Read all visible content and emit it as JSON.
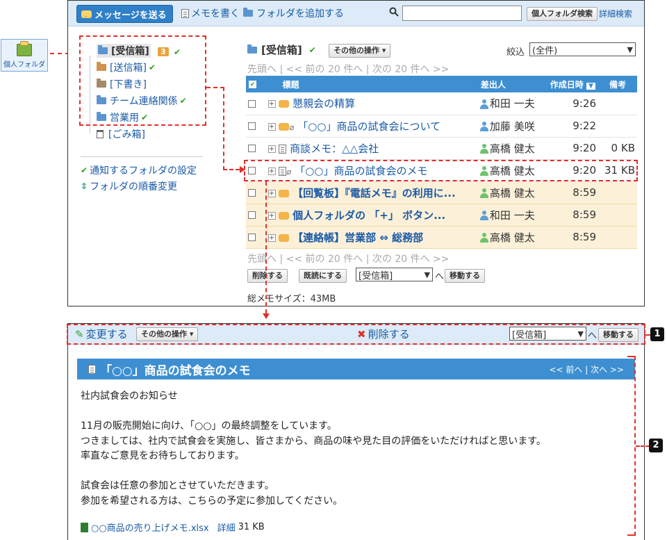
{
  "toolbar": {
    "send_label": "メッセージを送る",
    "memo_label": "メモを書く",
    "add_folder_label": "フォルダを追加する",
    "search_placeholder": "",
    "search_btn": "個人フォルダ検索",
    "adv_search": "詳細検索"
  },
  "personal_folder_icon_label": "個人フォルダ",
  "folders": [
    {
      "label": "[受信箱]",
      "badge": "3",
      "checked": true
    },
    {
      "label": "[送信箱]",
      "checked": true
    },
    {
      "label": "[下書き]",
      "checked": false
    },
    {
      "label": "チーム連絡関係",
      "checked": true
    },
    {
      "label": "営業用",
      "checked": true
    },
    {
      "label": "[ごみ箱]",
      "checked": false
    }
  ],
  "sidebar_links": {
    "notify": "通知するフォルダの設定",
    "order": "フォルダの順番変更"
  },
  "list": {
    "folder_title": "[受信箱]",
    "other_ops": "その他の操作",
    "filter_label": "絞込",
    "filter_value": "(全件)",
    "pager": {
      "first": "先頭へ",
      "prev": "<< 前の 20 件へ",
      "next": "次の 20 件へ >>"
    },
    "columns": {
      "subject": "標題",
      "sender": "差出人",
      "date": "作成日時",
      "note": "備考"
    },
    "rows": [
      {
        "subject": "懇親会の精算",
        "sender": "和田 一夫",
        "time": "9:26",
        "note": "",
        "unread": false,
        "icon": "bubble",
        "clip": false,
        "sender_color": "#5ba0d8"
      },
      {
        "subject": "「○○」商品の試食会について",
        "sender": "加藤 美咲",
        "time": "9:22",
        "note": "",
        "unread": false,
        "icon": "bubble-forward",
        "clip": true,
        "sender_color": "#5ba0d8"
      },
      {
        "subject": "商談メモ：△△会社",
        "sender": "高橋 健太",
        "time": "9:20",
        "note": "0 KB",
        "unread": false,
        "icon": "memo",
        "clip": false,
        "sender_color": "#6cc36c"
      },
      {
        "subject": "「○○」商品の試食会のメモ",
        "sender": "高橋 健太",
        "time": "9:20",
        "note": "31 KB",
        "unread": false,
        "icon": "memo",
        "clip": true,
        "sender_color": "#6cc36c"
      },
      {
        "subject": "【回覧板】『電話メモ』の利用に...",
        "sender": "高橋 健太",
        "time": "8:59",
        "note": "",
        "unread": true,
        "icon": "bubble",
        "clip": false,
        "sender_color": "#6cc36c"
      },
      {
        "subject": "個人フォルダの 「+」 ボタン...",
        "sender": "和田 一夫",
        "time": "8:59",
        "note": "",
        "unread": true,
        "icon": "bubble",
        "clip": false,
        "sender_color": "#5ba0d8"
      },
      {
        "subject": "【連絡帳】営業部 ⇔ 総務部",
        "sender": "高橋 健太",
        "time": "8:59",
        "note": "",
        "unread": true,
        "icon": "bubble",
        "clip": false,
        "sender_color": "#6cc36c"
      }
    ],
    "delete_btn": "削除する",
    "mark_read_btn": "既読にする",
    "move_select": "[受信箱]",
    "move_to": "へ",
    "move_btn": "移動する",
    "total_size": "総メモサイズ：43MB"
  },
  "detail": {
    "edit": "変更する",
    "other_ops": "その他の操作",
    "delete": "削除する",
    "move_select": "[受信箱]",
    "move_to": "へ",
    "move_btn": "移動する",
    "title": "「○○」商品の試食会のメモ",
    "nav": "<< 前へ | 次へ >>",
    "body_lines": [
      "社内試食会のお知らせ",
      "",
      "11月の販売開始に向け、「○○」の最終調整をしています。",
      "つきましては、社内で試食会を実施し、皆さまから、商品の味や見た目の評価をいただければと思います。",
      "率直なご意見をお待ちしております。",
      "",
      "試食会は任意の参加とさせていただきます。",
      "参加を希望される方は、こちらの予定に参加してください。"
    ],
    "attachment": "○○商品の売り上げメモ.xlsx",
    "attachment_detail": "詳細",
    "attachment_size": "31 KB"
  },
  "callouts": [
    "1",
    "2"
  ],
  "colors": {
    "accent": "#3d8fd1",
    "highlight": "#e0302a",
    "unread_bg": "#fcf0d8"
  }
}
